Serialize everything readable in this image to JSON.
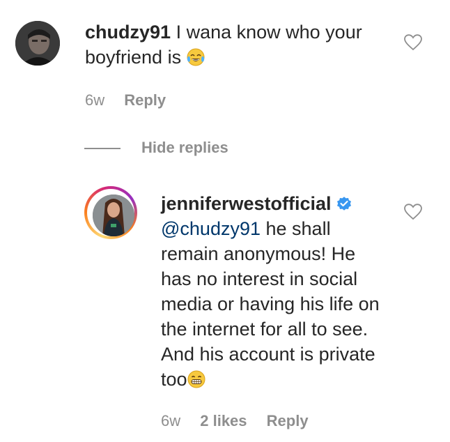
{
  "comments": [
    {
      "username": "chudzy91",
      "text": "I wana know who your boyfriend is",
      "emoji": "face-with-tears-of-joy",
      "time": "6w",
      "reply_label": "Reply"
    }
  ],
  "thread": {
    "hide_replies_label": "Hide replies"
  },
  "replies": [
    {
      "username": "jenniferwestofficial",
      "verified": true,
      "mention": "@chudzy91",
      "text": " he shall remain anonymous! He has no interest in social media or having his life on the internet for all to see. And his account is private too",
      "emoji": "grinning-face-with-smiling-eyes",
      "time": "6w",
      "likes": "2 likes",
      "reply_label": "Reply"
    }
  ],
  "colors": {
    "text": "#262626",
    "secondary": "#8e8e8e",
    "mention": "#00376b",
    "verified": "#3897f0"
  },
  "icons": {
    "like": "heart-outline-icon",
    "verified": "verified-badge-icon"
  }
}
